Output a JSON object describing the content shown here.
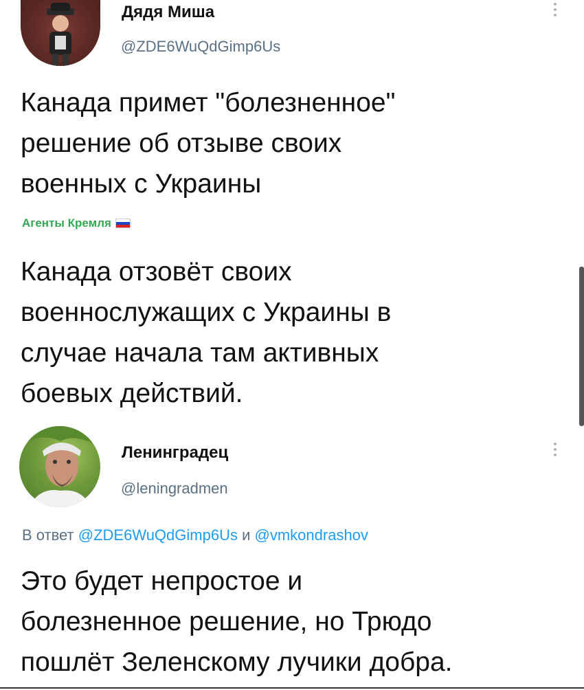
{
  "tweet1": {
    "display_name": "Дядя Миша",
    "handle": "@ZDE6WuQdGimp6Us",
    "text_lines": [
      "Канада примет \"болезненное\"",
      "решение об отзыве своих",
      "военных с Украины"
    ]
  },
  "embedded": {
    "channel": "Агенты Кремля",
    "flag_icon": "russian-flag-icon",
    "text_lines": [
      "Канада отзовёт своих",
      "военнослужащих с Украины в",
      "случае начала там активных",
      "боевых действий."
    ]
  },
  "tweet2": {
    "display_name": "Ленинградец",
    "handle": "@leningradmen",
    "reply_prefix": "В ответ",
    "reply_user1": "@ZDE6WuQdGimp6Us",
    "reply_and": "и",
    "reply_user2": "@vmkondrashov",
    "text_lines": [
      "Это будет непростое и",
      "болезненное решение, но Трюдо",
      "пошлёт Зеленскому лучики добра."
    ]
  },
  "colors": {
    "link": "#1d9bf0",
    "handle": "#5b7083",
    "channel": "#33a852"
  }
}
